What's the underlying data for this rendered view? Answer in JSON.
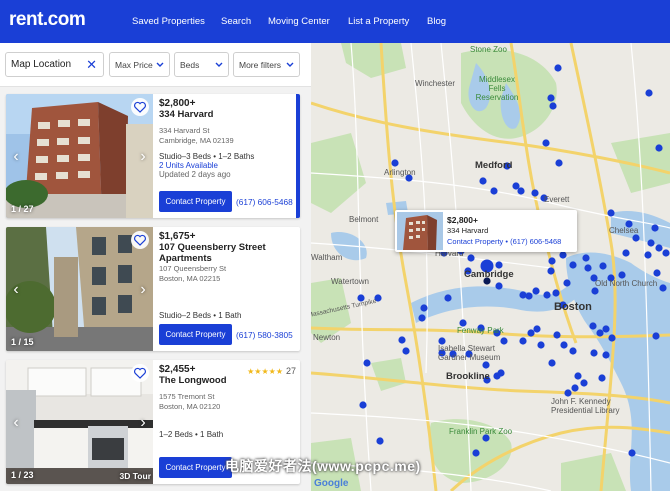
{
  "header": {
    "logo": "rent.com",
    "nav": [
      "Saved Properties",
      "Search",
      "Moving Center",
      "List a Property",
      "Blog"
    ]
  },
  "filters": {
    "location_value": "Map Location",
    "max_price": "Max Price",
    "beds": "Beds",
    "more": "More filters"
  },
  "listings": [
    {
      "price": "$2,800+",
      "name": "334 Harvard",
      "street": "334 Harvard St",
      "city": "Cambridge, MA 02139",
      "beds": "Studio–3 Beds • 1–2 Baths",
      "units": "2 Units Available",
      "updated": "Updated 2 days ago",
      "photo_count": "1 / 27",
      "contact": "Contact Property",
      "phone": "(617) 606-5468"
    },
    {
      "price": "$1,675+",
      "name": "107 Queensberry Street Apartments",
      "street": "107 Queensberry St",
      "city": "Boston, MA 02215",
      "beds": "Studio–2 Beds • 1 Bath",
      "photo_count": "1 / 15",
      "contact": "Contact Property",
      "phone": "(617) 580-3805"
    },
    {
      "price": "$2,455+",
      "name": "The Longwood",
      "street": "1575 Tremont St",
      "city": "Boston, MA 02120",
      "beds": "1–2 Beds • 1 Bath",
      "photo_count": "1 / 23",
      "tour": "3D Tour",
      "rating": "★★★★★",
      "review_count": "27",
      "contact": "Contact Property"
    }
  ],
  "map": {
    "labels": {
      "stone_zoo": "Stone Zoo",
      "winchester": "Winchester",
      "middlesex_fells": "Middlesex Fells Reservation",
      "arlington": "Arlington",
      "medford": "Medford",
      "belmont": "Belmont",
      "everett": "Everett",
      "chelsea": "Chelsea",
      "harvard": "Harvard",
      "cambridge": "Cambridge",
      "waltham": "Waltham",
      "watertown": "Watertown",
      "old_north_church": "Old North Church",
      "boston": "Boston",
      "fenway_park": "Fenway Park",
      "isabella": "Isabella Stewart Gardner Museum",
      "brookline": "Brookline",
      "jfk_library": "John F. Kennedy Presidential Library",
      "franklin_park_zoo": "Franklin Park Zoo",
      "newton": "Newton",
      "massachusetts_turnpike": "Massachusetts Turnpike"
    },
    "popup": {
      "price": "$2,800+",
      "name": "334 Harvard",
      "contact": "Contact Property • (617) 606-5468"
    },
    "google": "Google"
  },
  "watermark": "电脑爱好者法(www.pcpc.me)",
  "colors": {
    "brand": "#1a3fd6",
    "pin": "#1a3fd6"
  }
}
